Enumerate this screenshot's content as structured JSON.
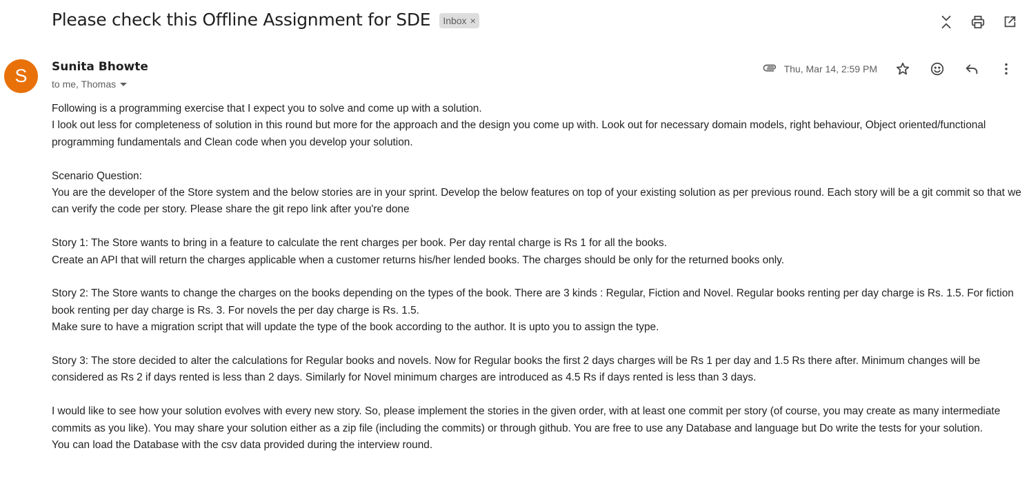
{
  "email": {
    "subject": "Please check this Offline Assignment for SDE",
    "label": "Inbox",
    "label_close": "×",
    "sender": {
      "initial": "S",
      "name": "Sunita Bhowte",
      "recipients": "to me, Thomas"
    },
    "date": "Thu, Mar 14, 2:59 PM",
    "colors": {
      "avatar": "#e8710a",
      "chip": "#dddddd"
    },
    "top_icons": [
      "collapse-icon",
      "print-icon",
      "open-in-new-window-icon"
    ],
    "meta_icons": [
      "attachment-icon",
      "star-icon",
      "emoji-icon",
      "reply-icon",
      "more-icon"
    ],
    "body": {
      "p1": "Following is a programming exercise that I expect you to solve and come up with a solution.",
      "p2": "I look out less for completeness of solution in this round but more for the approach and the design you come up with. Look out for necessary domain models, right behaviour, Object oriented/functional programming fundamentals and Clean code when you develop your solution.",
      "p3": "Scenario Question:",
      "p4": "You are the developer of the Store system and the below stories are in your sprint. Develop the below features on top of your existing solution as per previous round. Each story will be a git commit so that we can verify the code per story. Please share the git repo link after you're done",
      "p5": "Story 1: The Store wants to bring in a feature to calculate the rent charges per book. Per day rental charge is Rs 1 for all the books.",
      "p6": "Create an API that will return the charges applicable when a customer returns his/her lended books. The charges should be only for the returned books only.",
      "p7": "Story 2: The Store wants to change the charges on the books depending on the types of the book. There are 3 kinds : Regular, Fiction and Novel. Regular books renting per day charge is Rs. 1.5. For fiction book renting per day charge is Rs. 3. For novels the per day charge is Rs. 1.5.",
      "p8": "Make sure to have a migration script that will update the type of the book according to the author. It is upto you to assign the type.",
      "p9": "Story 3: The store decided to alter the calculations for Regular books and novels. Now for Regular books the first 2 days charges will be Rs 1 per day and 1.5 Rs there after. Minimum changes will be considered as Rs 2 if days rented is less than 2 days. Similarly for Novel minimum charges are introduced as 4.5 Rs if days rented is less than 3 days.",
      "p10": "I would like to see how your solution evolves with every new story. So, please implement the stories in the given order, with at least one commit per story (of course, you may create as many intermediate commits as you like). You may share your solution either as a zip file (including the commits) or through github. You are free to use any Database and language but Do write the tests for your solution.",
      "p11": "You can load the Database with the csv data provided during the interview round."
    }
  }
}
